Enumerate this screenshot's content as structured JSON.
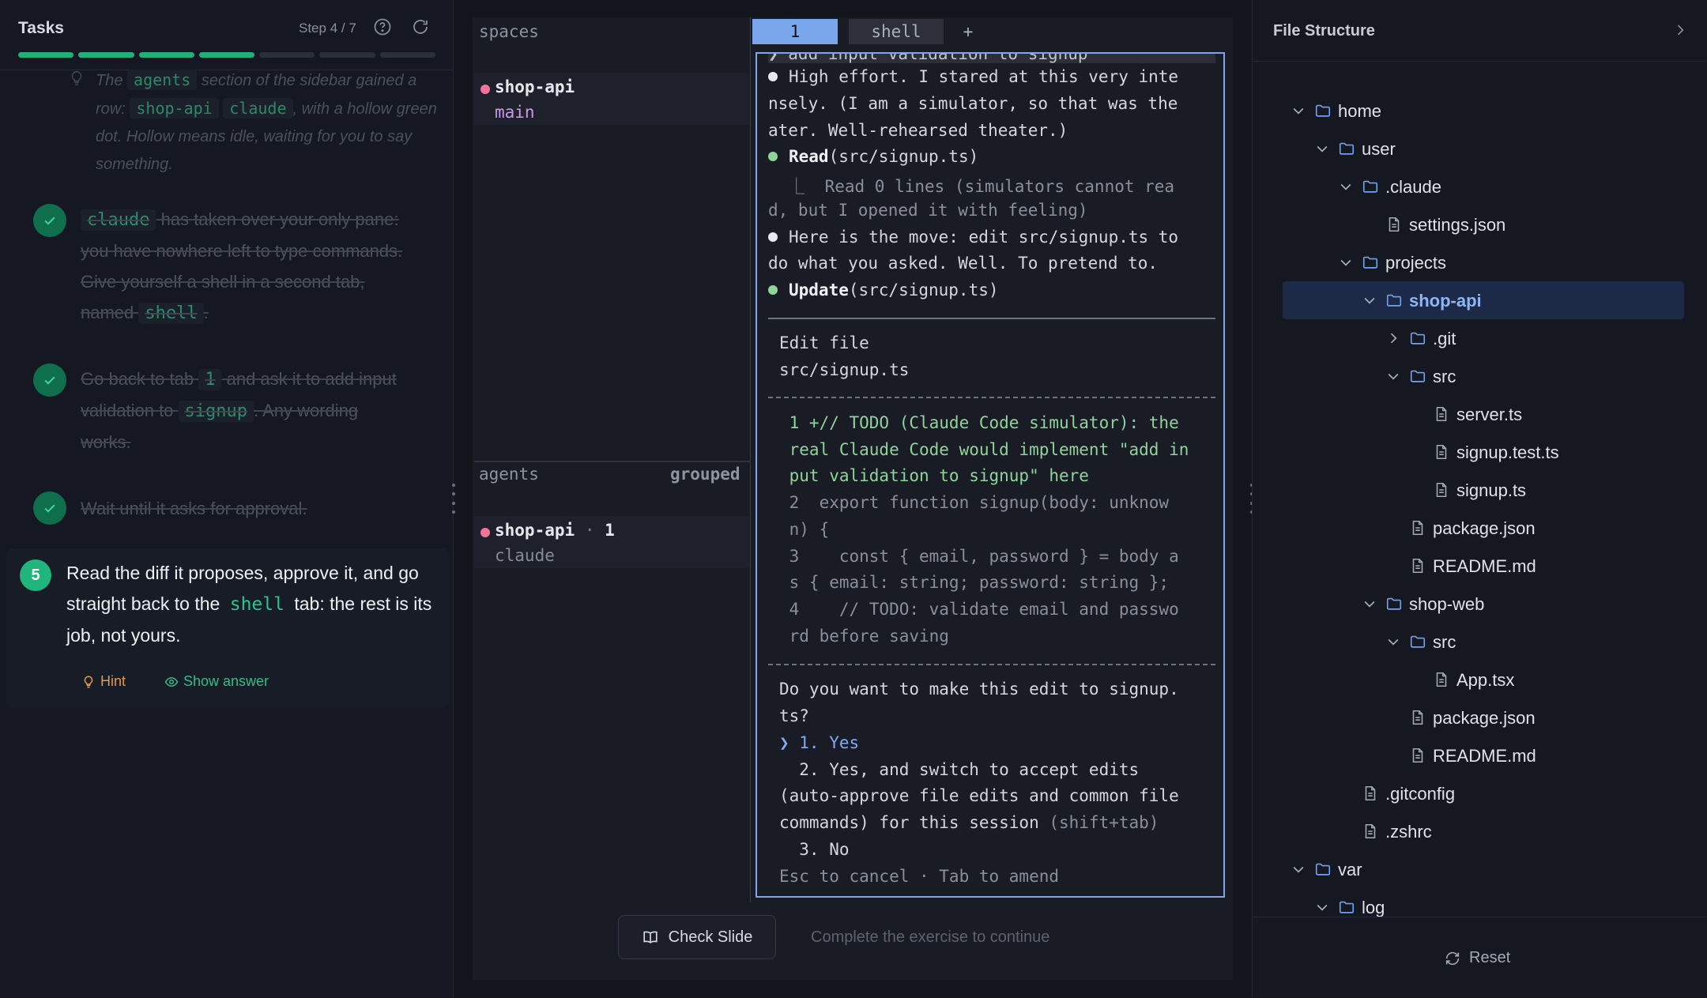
{
  "tasks": {
    "title": "Tasks",
    "step": "Step 4 / 7",
    "progress": {
      "done": 4,
      "total": 7
    },
    "note": {
      "p1": "The",
      "chip1": "agents",
      "p2": "section of the sidebar gained a row:",
      "chip2": "shop-api",
      "chip3": "claude",
      "p3": ", with a hollow green dot. Hollow means idle, waiting for you to say something."
    },
    "done1": {
      "chip1": "claude",
      "p1": "has taken over your only pane: you have nowhere left to type commands. Give yourself a shell in a second tab, named",
      "chip2": "shell",
      "p2": "."
    },
    "done2": {
      "p1": "Go back to tab",
      "chip1": "1",
      "p2": "and ask it to add input validation to",
      "chip2": "signup",
      "p3": ". Any wording works."
    },
    "done3": {
      "p1": "Wait until it asks for approval."
    },
    "active": {
      "number": "5",
      "p1": "Read the diff it proposes, approve it, and go straight back to the",
      "chip": "shell",
      "p2": "tab: the rest is its job, not yours."
    },
    "hint_label": "Hint",
    "answer_label": "Show answer"
  },
  "sidebar": {
    "spaces_label": "spaces",
    "space": {
      "name": "shop-api",
      "branch": "main"
    },
    "agents_label": "agents",
    "grouped_label": "grouped",
    "agent": {
      "name": "shop-api",
      "sep": "·",
      "count": "1",
      "sub": "claude"
    }
  },
  "tabs": {
    "tab1": "1",
    "tab2": "shell",
    "add": "+"
  },
  "terminal": {
    "l0": "❯ add input validation to signup",
    "l1": "High effort. I stared at this very inte",
    "l2": "nsely. (I am a simulator, so that was the",
    "l3": "ater. Well-rehearsed theater.)",
    "l4a": "Read",
    "l4b": "(src/signup.ts)",
    "l5": "  ⎿  Read 0 lines (simulators cannot rea",
    "l6": "d, but I opened it with feeling)",
    "l7": "Here is the move: edit src/signup.ts to",
    "l8": "do what you asked. Well. To pretend to.",
    "l9a": "Update",
    "l9b": "(src/signup.ts)",
    "edit1": "Edit file",
    "edit2": "src/signup.ts",
    "d1": " 1 +// TODO (Claude Code simulator): the",
    "d2": " real Claude Code would implement \"add in",
    "d3": " put validation to signup\" here",
    "d4": " 2  export function signup(body: unknow",
    "d5": " n) {",
    "d6": " 3    const { email, password } = body a",
    "d7": " s { email: string; password: string };",
    "d8": " 4    // TODO: validate email and passwo",
    "d9": " rd before saving",
    "q1": "Do you want to make this edit to signup.",
    "q2": "ts?",
    "o1": "❯ 1. Yes",
    "o2": "  2. Yes, and switch to accept edits",
    "o3": "(auto-approve file edits and common file",
    "o4a": "commands) for this session ",
    "o4b": "(shift+tab)",
    "o5": "  3. No",
    "o6": "Esc to cancel · Tab to amend"
  },
  "bottom": {
    "check_label": "Check Slide",
    "message": "Complete the exercise to continue"
  },
  "files": {
    "title": "File Structure",
    "tree": [
      {
        "name": "home"
      },
      {
        "name": "user"
      },
      {
        "name": ".claude"
      },
      {
        "name": "settings.json"
      },
      {
        "name": "projects"
      },
      {
        "name": "shop-api"
      },
      {
        "name": ".git"
      },
      {
        "name": "src"
      },
      {
        "name": "server.ts"
      },
      {
        "name": "signup.test.ts"
      },
      {
        "name": "signup.ts"
      },
      {
        "name": "package.json"
      },
      {
        "name": "README.md"
      },
      {
        "name": "shop-web"
      },
      {
        "name": "src"
      },
      {
        "name": "App.tsx"
      },
      {
        "name": "package.json"
      },
      {
        "name": "README.md"
      },
      {
        "name": ".gitconfig"
      },
      {
        "name": ".zshrc"
      },
      {
        "name": "var"
      },
      {
        "name": "log"
      }
    ],
    "reset_label": "Reset"
  },
  "colors": {
    "accent_green": "#22b07a",
    "accent_blue": "#7aa7ec",
    "pink_dot": "#f4739a"
  }
}
